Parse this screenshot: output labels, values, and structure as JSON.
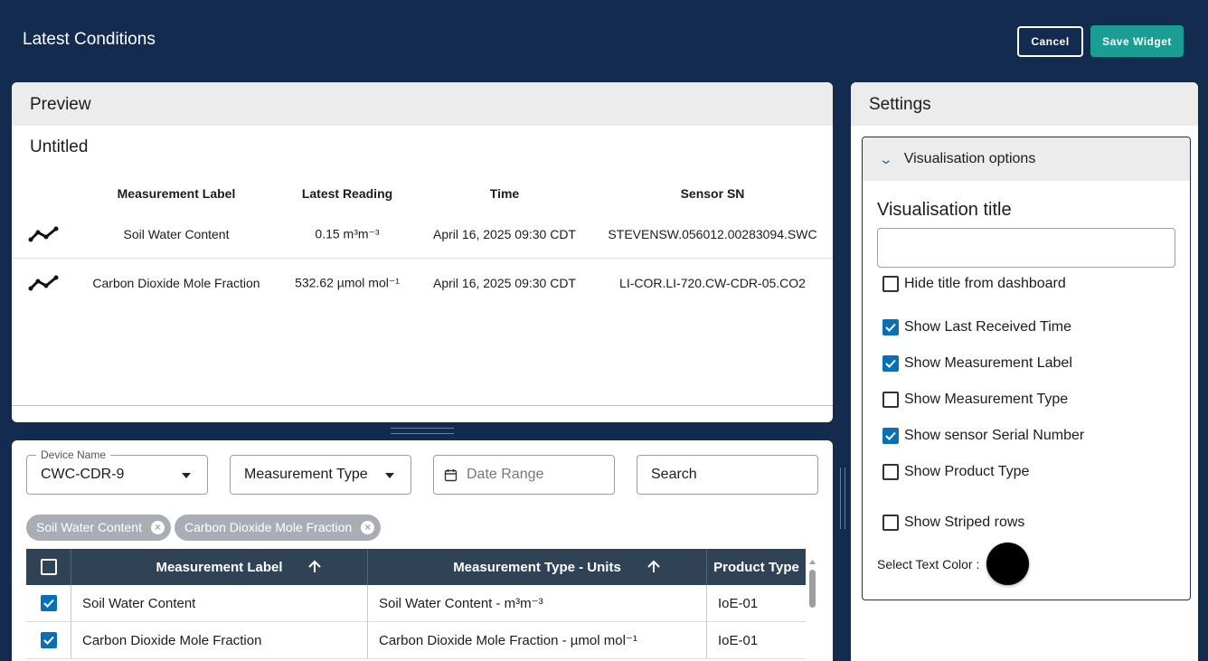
{
  "header": {
    "title": "Latest Conditions",
    "cancel_label": "Cancel",
    "save_label": "Save Widget"
  },
  "preview": {
    "header": "Preview",
    "widget_title": "Untitled",
    "columns": [
      "Measurement Label",
      "Latest Reading",
      "Time",
      "Sensor SN"
    ],
    "rows": [
      {
        "label": "Soil Water Content",
        "reading": "0.15 m³m⁻³",
        "time": "April 16, 2025 09:30 CDT",
        "sensor": "STEVENSW.056012.00283094.SWC",
        "icon": "trend-line-icon"
      },
      {
        "label": "Carbon Dioxide Mole Fraction",
        "reading": "532.62 µmol mol⁻¹",
        "time": "April 16, 2025 09:30 CDT",
        "sensor": "LI-COR.LI-720.CW-CDR-05.CO2",
        "icon": "trend-line-icon"
      }
    ]
  },
  "filters": {
    "device": {
      "label": "Device Name",
      "value": "CWC-CDR-9"
    },
    "measurement_type": {
      "placeholder": "Measurement Type"
    },
    "date_range": {
      "placeholder": "Date Range"
    },
    "search": {
      "placeholder": "Search"
    },
    "chips": [
      "Soil Water Content",
      "Carbon Dioxide Mole Fraction"
    ]
  },
  "measurements_table": {
    "columns": [
      "Measurement Label",
      "Measurement Type - Units",
      "Product Type"
    ],
    "rows": [
      {
        "checked": true,
        "label": "Soil Water Content",
        "type_units": "Soil Water Content - m³m⁻³",
        "product": "IoE-01"
      },
      {
        "checked": true,
        "label": "Carbon Dioxide Mole Fraction",
        "type_units": "Carbon Dioxide Mole Fraction - µmol mol⁻¹",
        "product": "IoE-01"
      }
    ]
  },
  "settings": {
    "header": "Settings",
    "accordion_title": "Visualisation options",
    "vis_title_label": "Visualisation title",
    "vis_title_value": "",
    "options": [
      {
        "label": "Hide title from dashboard",
        "checked": false
      },
      {
        "label": "Show Last Received Time",
        "checked": true
      },
      {
        "label": "Show Measurement Label",
        "checked": true
      },
      {
        "label": "Show Measurement Type",
        "checked": false
      },
      {
        "label": "Show sensor Serial Number",
        "checked": true
      },
      {
        "label": "Show Product Type",
        "checked": false
      },
      {
        "label": "Show Striped rows",
        "checked": false
      }
    ],
    "text_color_label": "Select Text Color :",
    "text_color": "#000000"
  },
  "colors": {
    "background": "#132b4f",
    "accent": "#1a9e94",
    "checkbox": "#0a6fb5",
    "table_header": "#2f4256"
  }
}
